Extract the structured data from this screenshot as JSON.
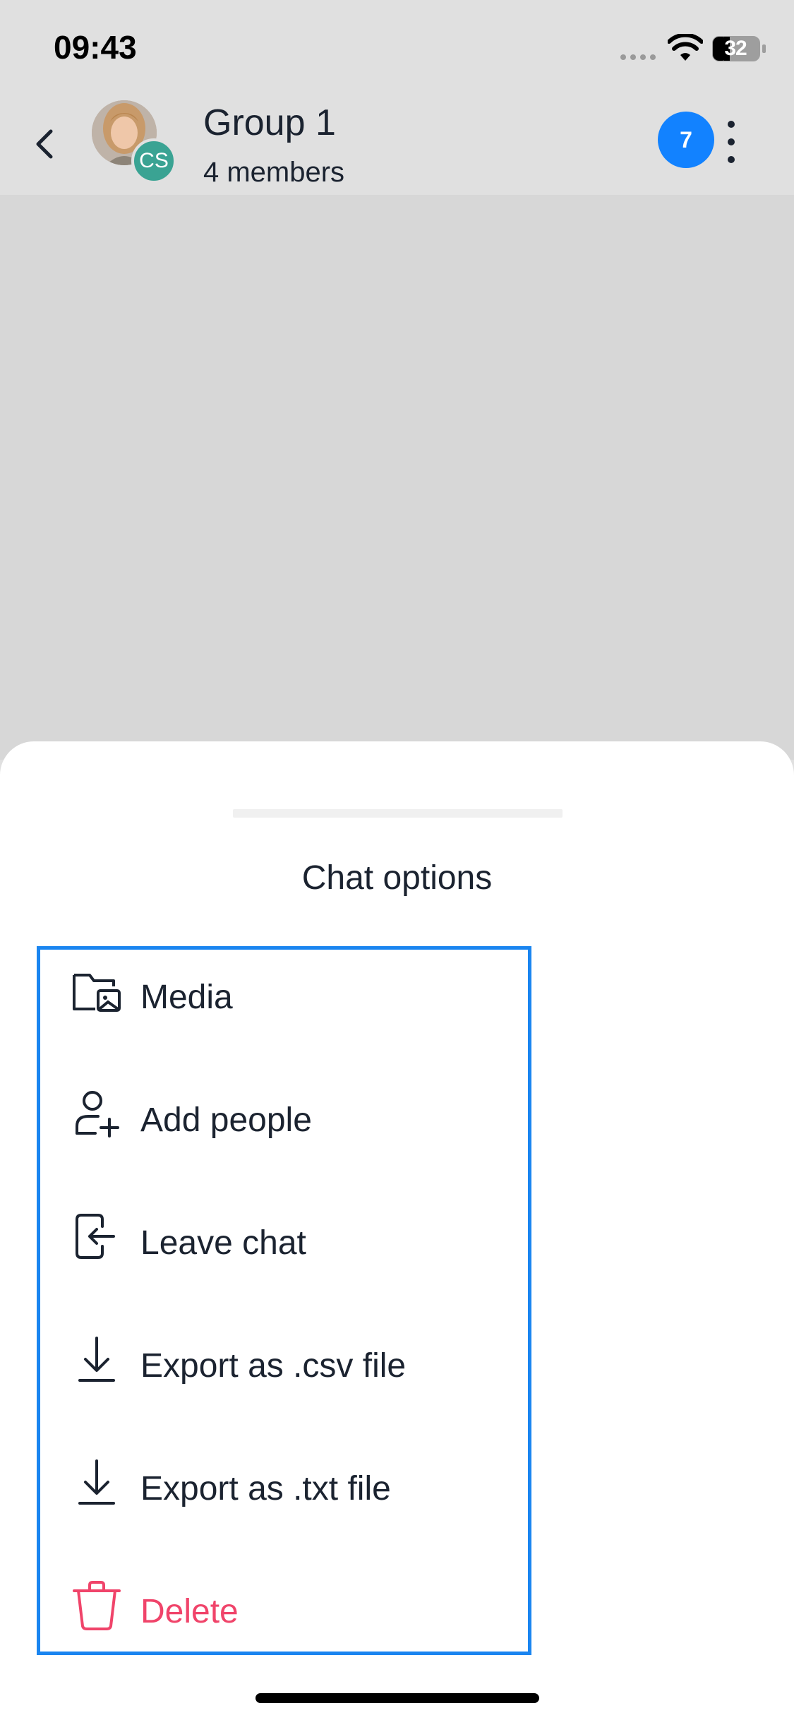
{
  "status_bar": {
    "time": "09:43",
    "battery": "32",
    "wifi_icon": "wifi-icon",
    "signal_icon": "cellular-signal-icon"
  },
  "header": {
    "back_icon": "chevron-left-icon",
    "title": "Group 1",
    "subtitle": "4 members",
    "avatar_initials": "CS",
    "unread_count": "7",
    "more_icon": "more-vertical-icon",
    "badge_color": "#1282ff"
  },
  "sheet": {
    "title": "Chat options",
    "options": [
      {
        "label": "Media",
        "icon": "media-folder-icon"
      },
      {
        "label": "Add people",
        "icon": "add-person-icon"
      },
      {
        "label": "Leave chat",
        "icon": "leave-chat-icon"
      },
      {
        "label": "Export as .csv file",
        "icon": "download-icon"
      },
      {
        "label": "Export as .txt file",
        "icon": "download-icon"
      },
      {
        "label": "Delete",
        "icon": "trash-icon",
        "color": "#f0446a"
      }
    ],
    "highlight_color": "#1a85f0"
  }
}
